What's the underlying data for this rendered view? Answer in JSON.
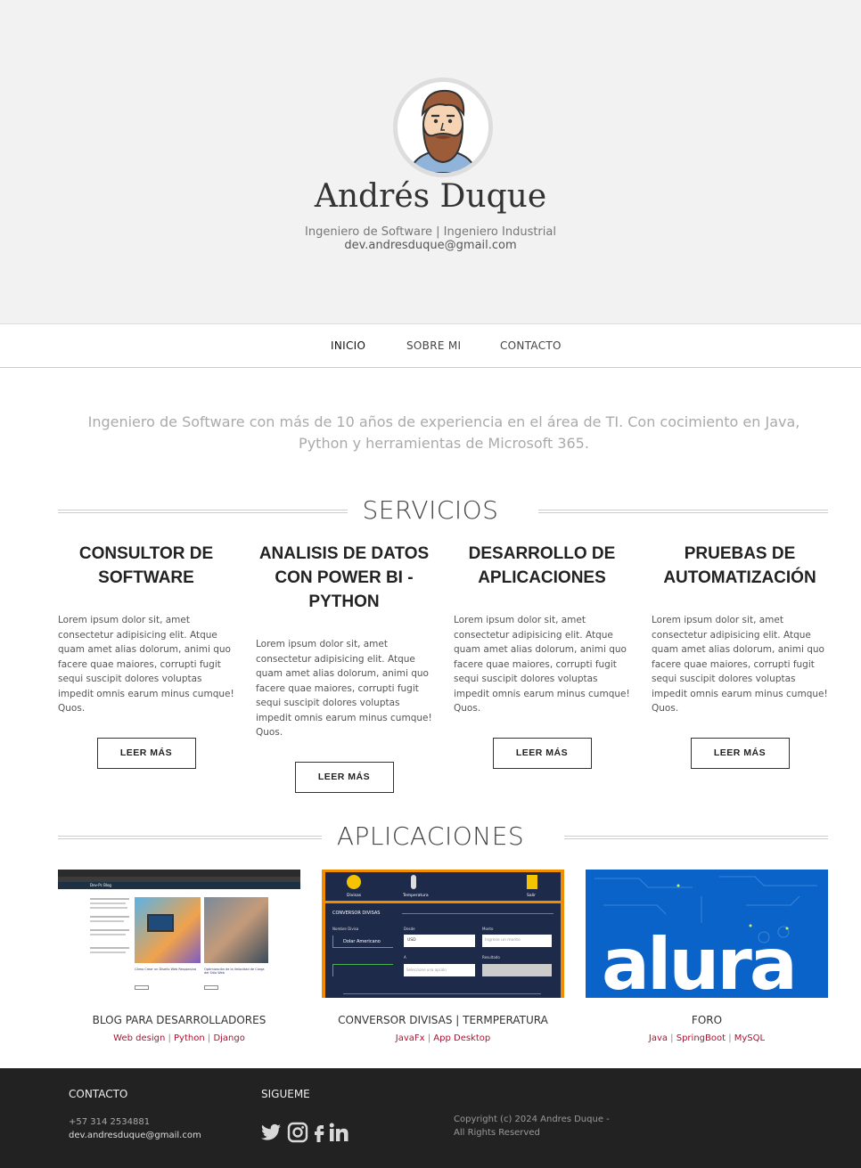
{
  "profile": {
    "name": "Andrés Duque",
    "subtitle": "Ingeniero de Software | Ingeniero Industrial",
    "email": "dev.andresduque@gmail.com"
  },
  "nav": {
    "items": [
      {
        "label": "INICIO",
        "active": true
      },
      {
        "label": "SOBRE MI",
        "active": false
      },
      {
        "label": "CONTACTO",
        "active": false
      }
    ]
  },
  "intro": "Ingeniero de Software con más de 10 años de experiencia en el área de TI. Con cocimiento en Java, Python y herramientas de Microsoft 365.",
  "services": {
    "heading": "SERVICIOS",
    "items": [
      {
        "title": "CONSULTOR DE SOFTWARE",
        "text": "Lorem ipsum dolor sit, amet consectetur adipisicing elit. Atque quam amet alias dolorum, animi quo facere quae maiores, corrupti fugit sequi suscipit dolores voluptas impedit omnis earum minus cumque! Quos.",
        "button": "LEER MÁS"
      },
      {
        "title": "ANALISIS DE DATOS CON POWER BI - PYTHON",
        "text": "Lorem ipsum dolor sit, amet consectetur adipisicing elit. Atque quam amet alias dolorum, animi quo facere quae maiores, corrupti fugit sequi suscipit dolores voluptas impedit omnis earum minus cumque! Quos.",
        "button": "LEER MÁS"
      },
      {
        "title": "DESARROLLO DE APLICACIONES",
        "text": "Lorem ipsum dolor sit, amet consectetur adipisicing elit. Atque quam amet alias dolorum, animi quo facere quae maiores, corrupti fugit sequi suscipit dolores voluptas impedit omnis earum minus cumque! Quos.",
        "button": "LEER MÁS"
      },
      {
        "title": "PRUEBAS DE AUTOMATIZACIÓN",
        "text": "Lorem ipsum dolor sit, amet consectetur adipisicing elit. Atque quam amet alias dolorum, animi quo facere quae maiores, corrupti fugit sequi suscipit dolores voluptas impedit omnis earum minus cumque! Quos.",
        "button": "LEER MÁS"
      }
    ]
  },
  "apps": {
    "heading": "APLICACIONES",
    "items": [
      {
        "title": "BLOG PARA DESARROLLADORES",
        "tags": [
          "Web design",
          "Python",
          "Django"
        ]
      },
      {
        "title": "CONVERSOR DIVISAS | TERMPERATURA",
        "tags": [
          "JavaFx",
          "App Desktop"
        ]
      },
      {
        "title": "FORO",
        "tags": [
          "Java",
          "SpringBoot",
          "MySQL"
        ]
      }
    ],
    "shots": {
      "blog_brand": "Dev-Pc Blog",
      "blog_caption_1": "Cómo Crear un Diseño Web Responsivo",
      "blog_caption_2": "Optimización de la Velocidad de Carga del Sitio Web",
      "conv_tabs": [
        "Divisas",
        "Temperatura",
        "Salir"
      ],
      "conv_title": "CONVERSOR DIVISAS",
      "conv_labels": [
        "Nombre Divisa",
        "Desde",
        "Monto",
        "Resultado",
        "A"
      ],
      "conv_value": "Dolar Americano",
      "conv_from": "USD",
      "conv_amount_placeholder": "Ingrese un monto",
      "conv_to_placeholder": "Seleccione una opción",
      "alura_logo": "alura"
    }
  },
  "footer": {
    "contact_heading": "CONTACTO",
    "phone": "+57 314 2534881",
    "email": "dev.andresduque@gmail.com",
    "follow_heading": "SIGUEME",
    "copyright": "Copyright (c) 2024 Andres Duque - All Rights Reserved",
    "social_icons": [
      "twitter-icon",
      "instagram-icon",
      "facebook-icon",
      "linkedin-icon"
    ]
  },
  "colors": {
    "hero_bg": "#f2f2f2",
    "footer_bg": "#222222",
    "tag_link": "#b01030",
    "converter_frame": "#f08c00",
    "alura_blue": "#0a63c9"
  }
}
